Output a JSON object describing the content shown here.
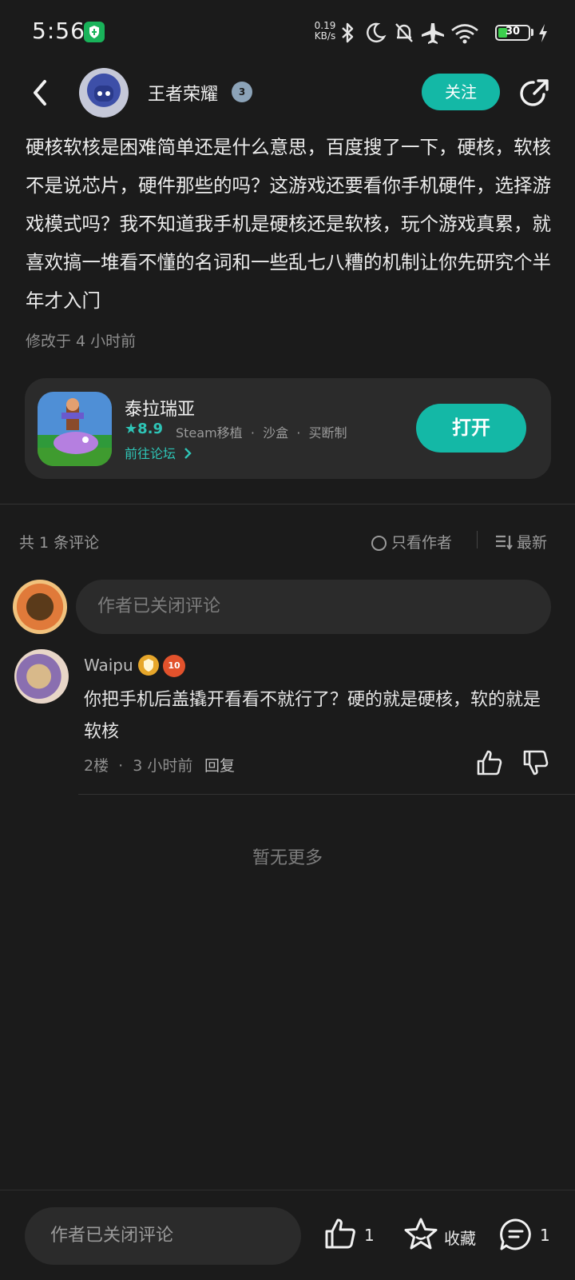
{
  "status_bar": {
    "time": "5:56",
    "net_speed_value": "0.19",
    "net_speed_unit": "KB/s",
    "battery": "30",
    "battery_level": 0.3
  },
  "header": {
    "author_name": "王者荣耀",
    "level": "3",
    "follow_label": "关注"
  },
  "post": {
    "body": "硬核软核是困难简单还是什么意思，百度搜了一下，硬核，软核不是说芯片，硬件那些的吗？这游戏还要看你手机硬件，选择游戏模式吗？我不知道我手机是硬核还是软核，玩个游戏真累，就喜欢搞一堆看不懂的名词和一些乱七八糟的机制让你先研究个半年才入门",
    "edited": "修改于 4 小时前"
  },
  "game_card": {
    "title": "泰拉瑞亚",
    "rating": "8.9",
    "tags": "Steam移植  ·  沙盒  ·  买断制",
    "forum_link": "前往论坛",
    "open_label": "打开"
  },
  "comments_header": {
    "count": "共 1 条评论",
    "author_only": "只看作者",
    "sort": "最新"
  },
  "comment_input": {
    "placeholder": "作者已关闭评论"
  },
  "comment": {
    "user": "Waipu",
    "badge_level": "10",
    "text": "你把手机后盖撬开看看不就行了？硬的就是硬核，软的就是软核",
    "meta": "2楼  ·  3 小时前",
    "reply": "回复"
  },
  "no_more": "暂无更多",
  "bottom_bar": {
    "input": "作者已关闭评论",
    "likes": "1",
    "favorite": "收藏",
    "comments": "1"
  }
}
